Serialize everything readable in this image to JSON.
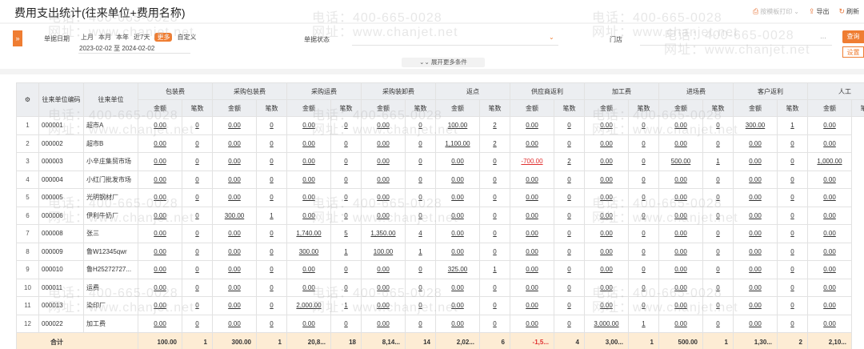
{
  "title": "费用支出统计(往来单位+费用名称)",
  "toolbar": {
    "print_label": "按模板打印",
    "export_label": "导出",
    "refresh_label": "刷新"
  },
  "filter": {
    "date_label": "单据日期",
    "quick_options": [
      "上月",
      "本月",
      "本年",
      "近7天",
      "更多",
      "自定义"
    ],
    "active_option": "更多",
    "date_range": "2023-02-02 至 2024-02-02",
    "status_label": "单据状态",
    "store_label": "门店",
    "expand_label": "展开更多条件",
    "query_label": "查询",
    "settings_label": "设置"
  },
  "watermark": {
    "phone": "电话：400-665-0028",
    "site": "网址：www.chanjet.net"
  },
  "table": {
    "col_code": "往来单位编码",
    "col_unit": "往来单位",
    "sub_amount": "金额",
    "sub_count": "笔数",
    "groups": [
      "包装费",
      "采购包装费",
      "采购运费",
      "采购装卸费",
      "返点",
      "供应商返利",
      "加工费",
      "进场费",
      "客户返利",
      "人工"
    ],
    "rows": [
      {
        "num": "1",
        "code": "000001",
        "unit": "超市A",
        "cells": [
          "0.00",
          "0",
          "0.00",
          "0",
          "0.00",
          "0",
          "0.00",
          "0",
          "100.00",
          "2",
          "0.00",
          "0",
          "0.00",
          "0",
          "0.00",
          "0",
          "300.00",
          "1",
          "0.00"
        ]
      },
      {
        "num": "2",
        "code": "000002",
        "unit": "超市B",
        "cells": [
          "0.00",
          "0",
          "0.00",
          "0",
          "0.00",
          "0",
          "0.00",
          "0",
          "1,100.00",
          "2",
          "0.00",
          "0",
          "0.00",
          "0",
          "0.00",
          "0",
          "0.00",
          "0",
          "0.00"
        ]
      },
      {
        "num": "3",
        "code": "000003",
        "unit": "小辛庄集贸市场",
        "cells": [
          "0.00",
          "0",
          "0.00",
          "0",
          "0.00",
          "0",
          "0.00",
          "0",
          "0.00",
          "0",
          "-700.00",
          "2",
          "0.00",
          "0",
          "500.00",
          "1",
          "0.00",
          "0",
          "1,000.00"
        ]
      },
      {
        "num": "4",
        "code": "000004",
        "unit": "小红门批发市场",
        "cells": [
          "0.00",
          "0",
          "0.00",
          "0",
          "0.00",
          "0",
          "0.00",
          "0",
          "0.00",
          "0",
          "0.00",
          "0",
          "0.00",
          "0",
          "0.00",
          "0",
          "0.00",
          "0",
          "0.00"
        ]
      },
      {
        "num": "5",
        "code": "000005",
        "unit": "光明钢材厂",
        "cells": [
          "0.00",
          "0",
          "0.00",
          "0",
          "0.00",
          "0",
          "0.00",
          "0",
          "0.00",
          "0",
          "0.00",
          "0",
          "0.00",
          "0",
          "0.00",
          "0",
          "0.00",
          "0",
          "0.00"
        ]
      },
      {
        "num": "6",
        "code": "000006",
        "unit": "伊利牛奶厂",
        "cells": [
          "0.00",
          "0",
          "300.00",
          "1",
          "0.00",
          "0",
          "0.00",
          "0",
          "0.00",
          "0",
          "0.00",
          "0",
          "0.00",
          "0",
          "0.00",
          "0",
          "0.00",
          "0",
          "0.00"
        ]
      },
      {
        "num": "7",
        "code": "000008",
        "unit": "张三",
        "cells": [
          "0.00",
          "0",
          "0.00",
          "0",
          "1,740.00",
          "5",
          "1,350.00",
          "4",
          "0.00",
          "0",
          "0.00",
          "0",
          "0.00",
          "0",
          "0.00",
          "0",
          "0.00",
          "0",
          "0.00"
        ]
      },
      {
        "num": "8",
        "code": "000009",
        "unit": "鲁W12345qwr",
        "cells": [
          "0.00",
          "0",
          "0.00",
          "0",
          "300.00",
          "1",
          "100.00",
          "1",
          "0.00",
          "0",
          "0.00",
          "0",
          "0.00",
          "0",
          "0.00",
          "0",
          "0.00",
          "0",
          "0.00"
        ]
      },
      {
        "num": "9",
        "code": "000010",
        "unit": "鲁H25272727...",
        "cells": [
          "0.00",
          "0",
          "0.00",
          "0",
          "0.00",
          "0",
          "0.00",
          "0",
          "325.00",
          "1",
          "0.00",
          "0",
          "0.00",
          "0",
          "0.00",
          "0",
          "0.00",
          "0",
          "0.00"
        ]
      },
      {
        "num": "10",
        "code": "000011",
        "unit": "运费",
        "cells": [
          "0.00",
          "0",
          "0.00",
          "0",
          "0.00",
          "0",
          "0.00",
          "0",
          "0.00",
          "0",
          "0.00",
          "0",
          "0.00",
          "0",
          "0.00",
          "0",
          "0.00",
          "0",
          "0.00"
        ]
      },
      {
        "num": "11",
        "code": "000013",
        "unit": "染印厂",
        "cells": [
          "0.00",
          "0",
          "0.00",
          "0",
          "2,000.00",
          "1",
          "0.00",
          "0",
          "0.00",
          "0",
          "0.00",
          "0",
          "0.00",
          "0",
          "0.00",
          "0",
          "0.00",
          "0",
          "0.00"
        ]
      },
      {
        "num": "12",
        "code": "000022",
        "unit": "加工费",
        "cells": [
          "0.00",
          "0",
          "0.00",
          "0",
          "0.00",
          "0",
          "0.00",
          "0",
          "0.00",
          "0",
          "0.00",
          "0",
          "3,000.00",
          "1",
          "0.00",
          "0",
          "0.00",
          "0",
          "0.00"
        ]
      }
    ],
    "total": {
      "label": "合计",
      "cells": [
        "100.00",
        "1",
        "300.00",
        "1",
        "20,8...",
        "18",
        "8,14...",
        "14",
        "2,02...",
        "6",
        "-1,5...",
        "4",
        "3,00...",
        "1",
        "500.00",
        "1",
        "1,30...",
        "2",
        "2,10..."
      ]
    }
  }
}
